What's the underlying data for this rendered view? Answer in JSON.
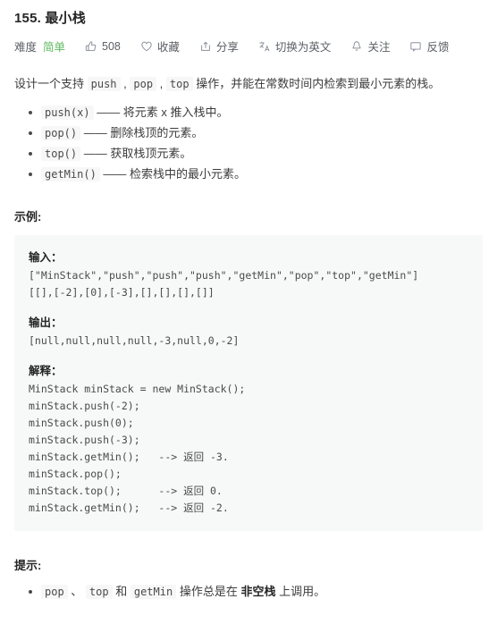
{
  "header": {
    "title": "155. 最小栈",
    "difficulty_label": "难度",
    "difficulty_value": "简单",
    "difficulty_color": "#5cb85c",
    "toolbar": [
      {
        "icon": "thumbs-up-icon",
        "label": "508"
      },
      {
        "icon": "heart-icon",
        "label": "收藏"
      },
      {
        "icon": "share-icon",
        "label": "分享"
      },
      {
        "icon": "translate-icon",
        "label": "切换为英文"
      },
      {
        "icon": "bell-icon",
        "label": "关注"
      },
      {
        "icon": "feedback-icon",
        "label": "反馈"
      }
    ]
  },
  "description": {
    "prefix": "设计一个支持 ",
    "code1": "push",
    "sep1": " , ",
    "code2": "pop",
    "sep2": " , ",
    "code3": "top",
    "suffix": " 操作，并能在常数时间内检索到最小元素的栈。",
    "bullets": [
      {
        "code": "push(x)",
        "text": " —— 将元素 x 推入栈中。"
      },
      {
        "code": "pop()",
        "text": " —— 删除栈顶的元素。"
      },
      {
        "code": "top()",
        "text": " —— 获取栈顶元素。"
      },
      {
        "code": "getMin()",
        "text": " —— 检索栈中的最小元素。"
      }
    ]
  },
  "example": {
    "heading": "示例:",
    "input_label": "输入：",
    "input_lines": [
      "[\"MinStack\",\"push\",\"push\",\"push\",\"getMin\",\"pop\",\"top\",\"getMin\"]",
      "[[],[-2],[0],[-3],[],[],[],[]]"
    ],
    "output_label": "输出：",
    "output_lines": [
      "[null,null,null,null,-3,null,0,-2]"
    ],
    "explain_label": "解释：",
    "explain_lines": [
      "MinStack minStack = new MinStack();",
      "minStack.push(-2);",
      "minStack.push(0);",
      "minStack.push(-3);",
      "minStack.getMin();   --> 返回 -3.",
      "minStack.pop();",
      "minStack.top();      --> 返回 0.",
      "minStack.getMin();   --> 返回 -2."
    ]
  },
  "hints": {
    "heading": "提示:",
    "item": {
      "c1": "pop",
      "s1": " 、 ",
      "c2": "top",
      "s2": " 和 ",
      "c3": "getMin",
      "mid": " 操作总是在 ",
      "strong": "非空栈",
      "tail": " 上调用。"
    }
  }
}
